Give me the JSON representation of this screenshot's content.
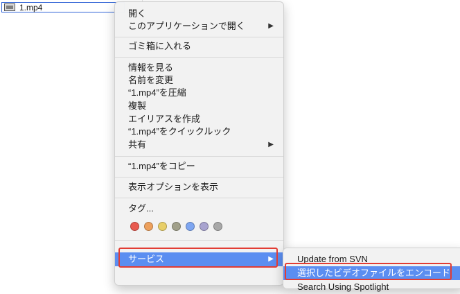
{
  "file": {
    "name": "1.mp4"
  },
  "menu": {
    "items": [
      {
        "label": "開く"
      },
      {
        "label": "このアプリケーションで開く",
        "submenu": true
      },
      {
        "label": "ゴミ箱に入れる"
      },
      {
        "label": "情報を見る"
      },
      {
        "label": "名前を変更"
      },
      {
        "label": "“1.mp4”を圧縮"
      },
      {
        "label": "複製"
      },
      {
        "label": "エイリアスを作成"
      },
      {
        "label": "“1.mp4”をクイックルック"
      },
      {
        "label": "共有",
        "submenu": true
      },
      {
        "label": "“1.mp4”をコピー"
      },
      {
        "label": "表示オプションを表示"
      },
      {
        "label": "タグ..."
      },
      {
        "label": "サービス",
        "submenu": true,
        "highlighted": true
      }
    ],
    "tags": [
      {
        "name": "red",
        "color": "#e85a4f"
      },
      {
        "name": "orange",
        "color": "#eda05c"
      },
      {
        "name": "yellow",
        "color": "#e8cf69"
      },
      {
        "name": "green",
        "color": "#a1a08a"
      },
      {
        "name": "blue",
        "color": "#7ea6f1"
      },
      {
        "name": "purple",
        "color": "#a8a3cf"
      },
      {
        "name": "gray",
        "color": "#a8a8a8"
      }
    ]
  },
  "submenu": {
    "items": [
      {
        "label": "Update from SVN"
      },
      {
        "label": "選択したビデオファイルをエンコード",
        "highlighted": true
      },
      {
        "label": "Search Using Spotlight"
      }
    ]
  },
  "colors": {
    "highlight": "#5b8ef1",
    "annotation": "#e23c33"
  }
}
